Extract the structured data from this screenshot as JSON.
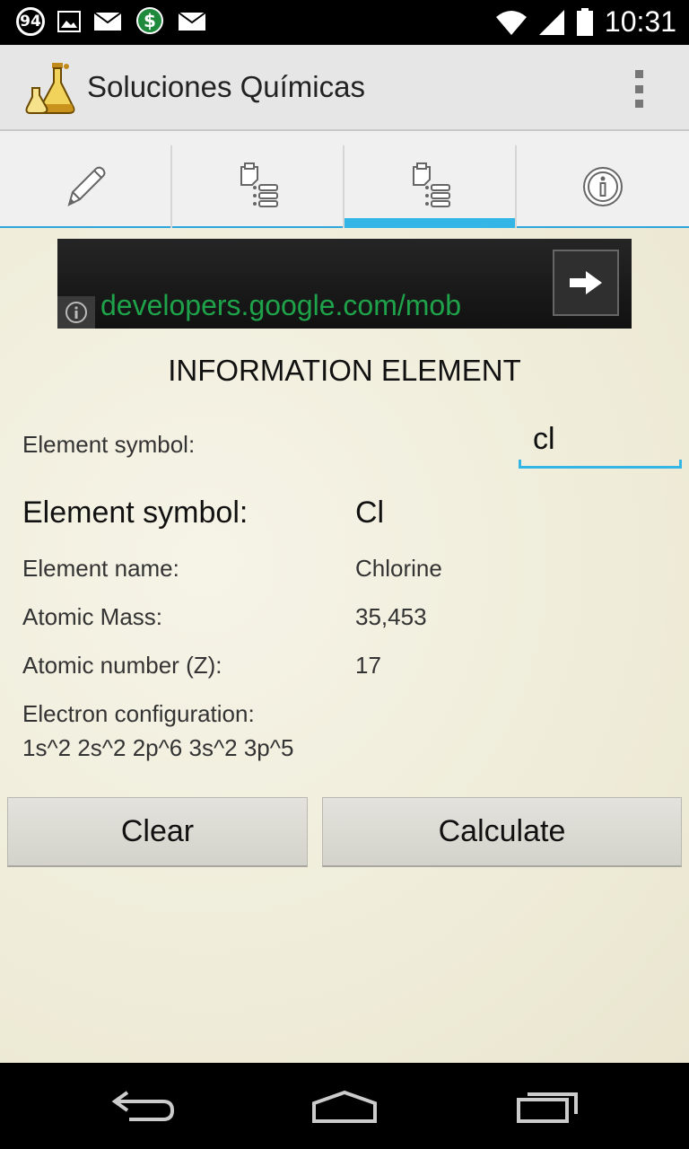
{
  "status_bar": {
    "notification_count": "94",
    "time": "10:31",
    "icons": [
      "image-icon",
      "mail-icon",
      "dollar-icon",
      "mail-icon",
      "wifi-icon",
      "signal-icon",
      "battery-icon"
    ]
  },
  "action_bar": {
    "title": "Soluciones Químicas",
    "logo": "flasks-logo",
    "overflow_icon": "overflow-menu-icon"
  },
  "tabs": [
    {
      "icon": "pencil-icon",
      "selected": false
    },
    {
      "icon": "clipboard-list-icon",
      "selected": false
    },
    {
      "icon": "clipboard-list-icon",
      "selected": true
    },
    {
      "icon": "info-icon",
      "selected": false
    }
  ],
  "ad": {
    "text": "developers.google.com/mob",
    "info_icon": "info-icon",
    "arrow_icon": "arrow-right-icon"
  },
  "main": {
    "heading": "INFORMATION ELEMENT",
    "input_label": "Element symbol:",
    "input_value": "cl",
    "result_symbol_label": "Element symbol:",
    "result_symbol_value": "Cl",
    "name_label": "Element name:",
    "name_value": "Chlorine",
    "mass_label": "Atomic Mass:",
    "mass_value": "35,453",
    "number_label": "Atomic number (Z):",
    "number_value": "17",
    "config_label": "Electron configuration:",
    "config_value": "1s^2 2s^2 2p^6 3s^2 3p^5"
  },
  "buttons": {
    "clear": "Clear",
    "calculate": "Calculate"
  },
  "colors": {
    "accent": "#33b5e5",
    "ad_text": "#1fa34a"
  },
  "nav_bar": [
    "back-icon",
    "home-icon",
    "recent-apps-icon"
  ]
}
